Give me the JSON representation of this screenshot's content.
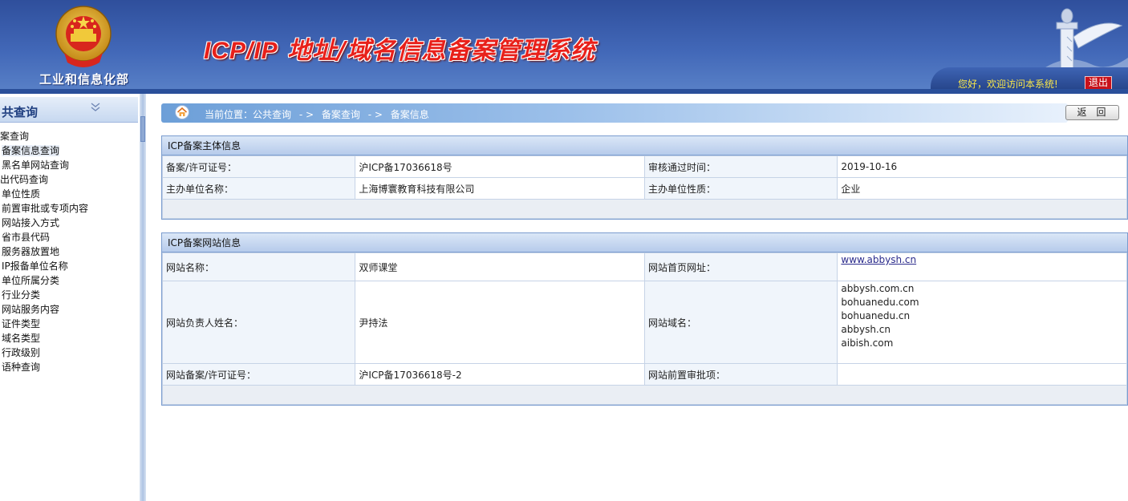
{
  "header": {
    "ministry": "工业和信息化部",
    "title_prefix": "ICP/IP",
    "title_rest": " 地址/域名信息备案管理系统",
    "greeting": "您好，欢迎访问本系统!",
    "logout": "退出"
  },
  "sidebar": {
    "title": "共查询",
    "items": [
      {
        "label": "案查询"
      },
      {
        "label": "备案信息查询"
      },
      {
        "label": "黑名单网站查询"
      },
      {
        "label": "出代码查询"
      },
      {
        "label": "单位性质"
      },
      {
        "label": "前置审批或专项内容"
      },
      {
        "label": "网站接入方式"
      },
      {
        "label": "省市县代码"
      },
      {
        "label": "服务器放置地"
      },
      {
        "label": "IP报备单位名称"
      },
      {
        "label": "单位所属分类"
      },
      {
        "label": "行业分类"
      },
      {
        "label": "网站服务内容"
      },
      {
        "label": "证件类型"
      },
      {
        "label": "域名类型"
      },
      {
        "label": "行政级别"
      },
      {
        "label": "语种查询"
      }
    ]
  },
  "breadcrumb": {
    "prefix": "当前位置：公共查询",
    "sep": "- >",
    "level2": "备案查询",
    "level3": "备案信息"
  },
  "back_button": "返回",
  "subject_panel": {
    "title": "ICP备案主体信息",
    "license_label": "备案/许可证号：",
    "license_value": "沪ICP备17036618号",
    "approve_label": "审核通过时间：",
    "approve_value": "2019-10-16",
    "org_label": "主办单位名称：",
    "org_value": "上海博寰教育科技有限公司",
    "nature_label": "主办单位性质：",
    "nature_value": "企业"
  },
  "site_panel": {
    "title": "ICP备案网站信息",
    "name_label": "网站名称：",
    "name_value": "双师课堂",
    "home_label": "网站首页网址：",
    "home_value": "www.abbysh.cn",
    "owner_label": "网站负责人姓名：",
    "owner_value": "尹持法",
    "domain_label": "网站域名：",
    "domains": [
      "abbysh.com.cn",
      "bohuanedu.com",
      "bohuanedu.cn",
      "abbysh.cn",
      "aibish.com"
    ],
    "license_label": "网站备案/许可证号：",
    "license_value": "沪ICP备17036618号-2",
    "preapprove_label": "网站前置审批项：",
    "preapprove_value": ""
  },
  "colors": {
    "header_blue": "#3d61b0",
    "title_red": "#e8201a",
    "greeting_yellow": "#f7e54a",
    "logout_red": "#c8111a",
    "panel_border": "#7a9ccf"
  }
}
